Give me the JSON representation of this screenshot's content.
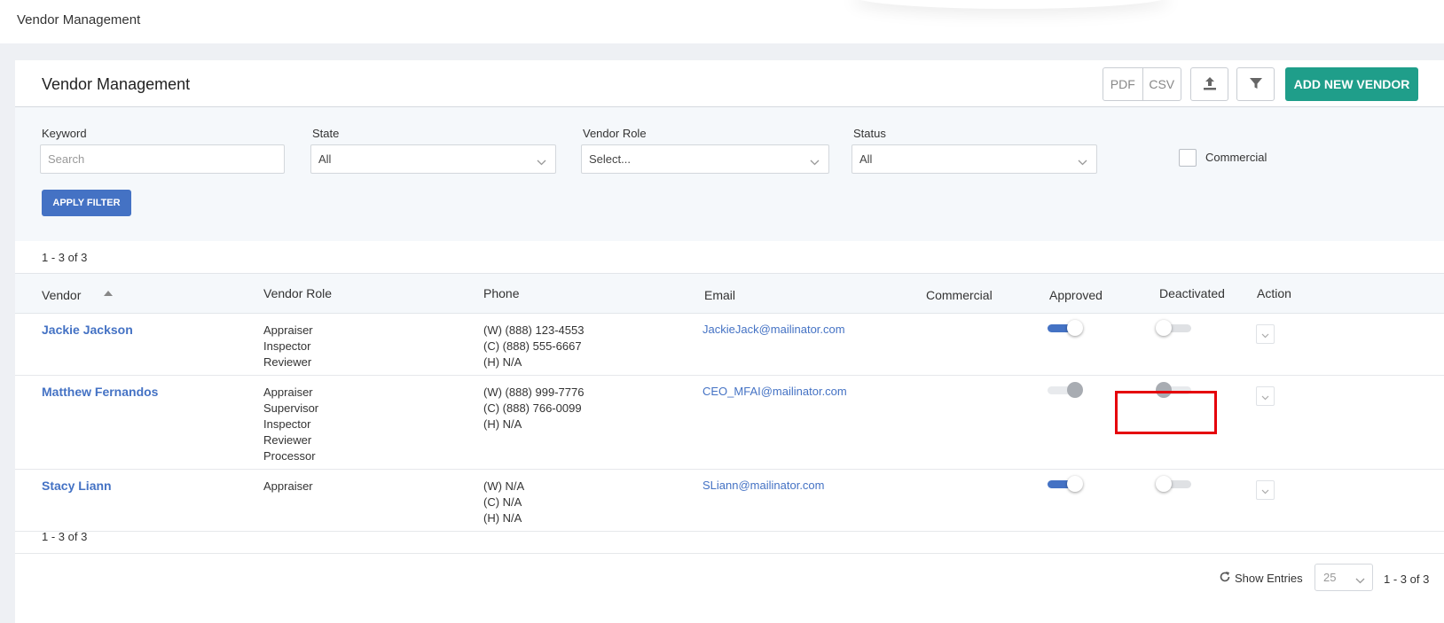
{
  "topbar": {
    "breadcrumb": "Vendor Management"
  },
  "header": {
    "title": "Vendor Management",
    "pdf_label": "PDF",
    "csv_label": "CSV",
    "upload_icon": "upload-icon",
    "filter_icon": "filter-icon",
    "add_label": "ADD NEW VENDOR",
    "accent_color": "#1f9e8a"
  },
  "filters": {
    "keyword": {
      "label": "Keyword",
      "placeholder": "Search",
      "value": ""
    },
    "state": {
      "label": "State",
      "value": "All"
    },
    "vendor_role": {
      "label": "Vendor Role",
      "value": "Select..."
    },
    "status": {
      "label": "Status",
      "value": "All"
    },
    "commercial": {
      "label": "Commercial",
      "checked": false
    },
    "apply_label": "APPLY FILTER",
    "apply_color": "#4472c4"
  },
  "summary": {
    "range_top": "1 - 3 of 3",
    "range_bottom": "1 - 3 of 3"
  },
  "table": {
    "columns": {
      "vendor": "Vendor",
      "vendor_role": "Vendor Role",
      "phone": "Phone",
      "email": "Email",
      "commercial": "Commercial",
      "approved": "Approved",
      "deactivated": "Deactivated",
      "action": "Action"
    },
    "sort": {
      "column": "vendor",
      "direction": "ascending"
    },
    "rows": [
      {
        "vendor": "Jackie Jackson",
        "roles": [
          "Appraiser",
          "Inspector",
          "Reviewer"
        ],
        "phones": [
          "(W) (888) 123-4553",
          "(C) (888) 555-6667",
          "(H) N/A"
        ],
        "email": "JackieJack@mailinator.com",
        "commercial": "",
        "approved": {
          "on": true,
          "disabled": false
        },
        "deactivated": {
          "on": false,
          "disabled": false
        }
      },
      {
        "vendor": "Matthew Fernandos",
        "roles": [
          "Appraiser",
          "Supervisor",
          "Inspector",
          "Reviewer",
          "Processor"
        ],
        "phones": [
          "(W) (888) 999-7776",
          "(C) (888) 766-0099",
          "(H) N/A"
        ],
        "email": "CEO_MFAI@mailinator.com",
        "commercial": "",
        "approved": {
          "on": true,
          "disabled": true
        },
        "deactivated": {
          "on": false,
          "disabled": true
        }
      },
      {
        "vendor": "Stacy Liann",
        "roles": [
          "Appraiser"
        ],
        "phones": [
          "(W) N/A",
          "(C) N/A",
          "(H) N/A"
        ],
        "email": "SLiann@mailinator.com",
        "commercial": "",
        "approved": {
          "on": true,
          "disabled": false
        },
        "deactivated": {
          "on": false,
          "disabled": false
        }
      }
    ]
  },
  "footer": {
    "refresh_icon": "refresh-icon",
    "show_entries_label": "Show Entries",
    "entries_value": "25",
    "range": "1 - 3 of 3"
  }
}
